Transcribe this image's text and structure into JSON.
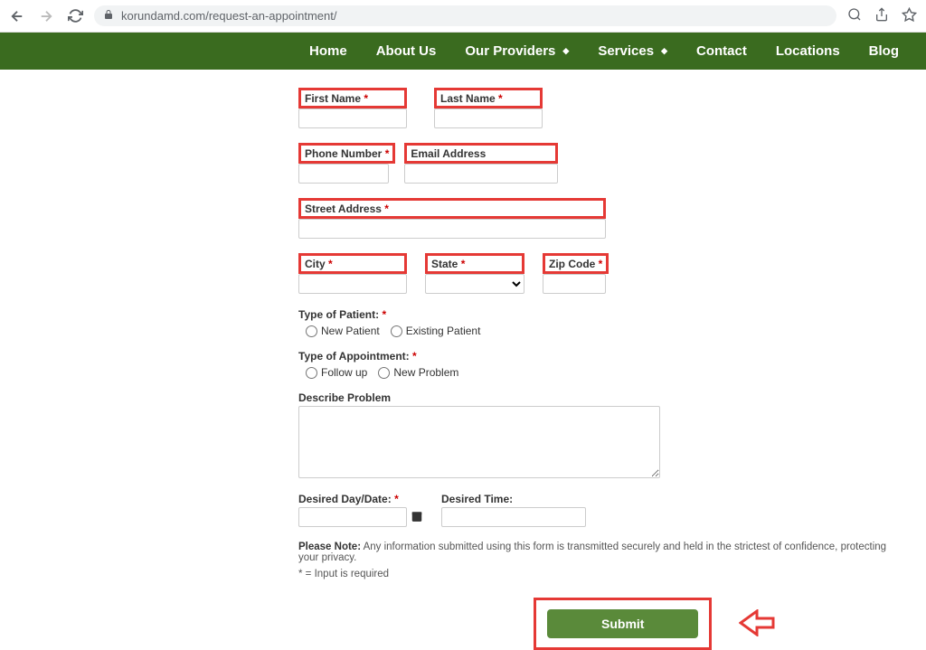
{
  "browser": {
    "url": "korundamd.com/request-an-appointment/"
  },
  "nav": {
    "items": [
      "Home",
      "About Us",
      "Our Providers",
      "Services",
      "Contact",
      "Locations",
      "Blog"
    ],
    "has_dropdown": [
      false,
      false,
      true,
      true,
      false,
      false,
      false
    ]
  },
  "form": {
    "first_name_label": "First Name",
    "last_name_label": "Last Name",
    "phone_label": "Phone Number",
    "email_label": "Email Address",
    "street_label": "Street Address",
    "city_label": "City",
    "state_label": "State",
    "zip_label": "Zip Code",
    "patient_type_label": "Type of Patient:",
    "patient_type_options": [
      "New Patient",
      "Existing Patient"
    ],
    "appointment_type_label": "Type of Appointment:",
    "appointment_type_options": [
      "Follow up",
      "New Problem"
    ],
    "describe_label": "Describe Problem",
    "desired_date_label": "Desired Day/Date:",
    "desired_time_label": "Desired Time:",
    "note_bold": "Please Note:",
    "note_text": "Any information submitted using this form is transmitted securely and held in the strictest of confidence, protecting your privacy.",
    "required_note": "* = Input is required",
    "submit_label": "Submit"
  }
}
